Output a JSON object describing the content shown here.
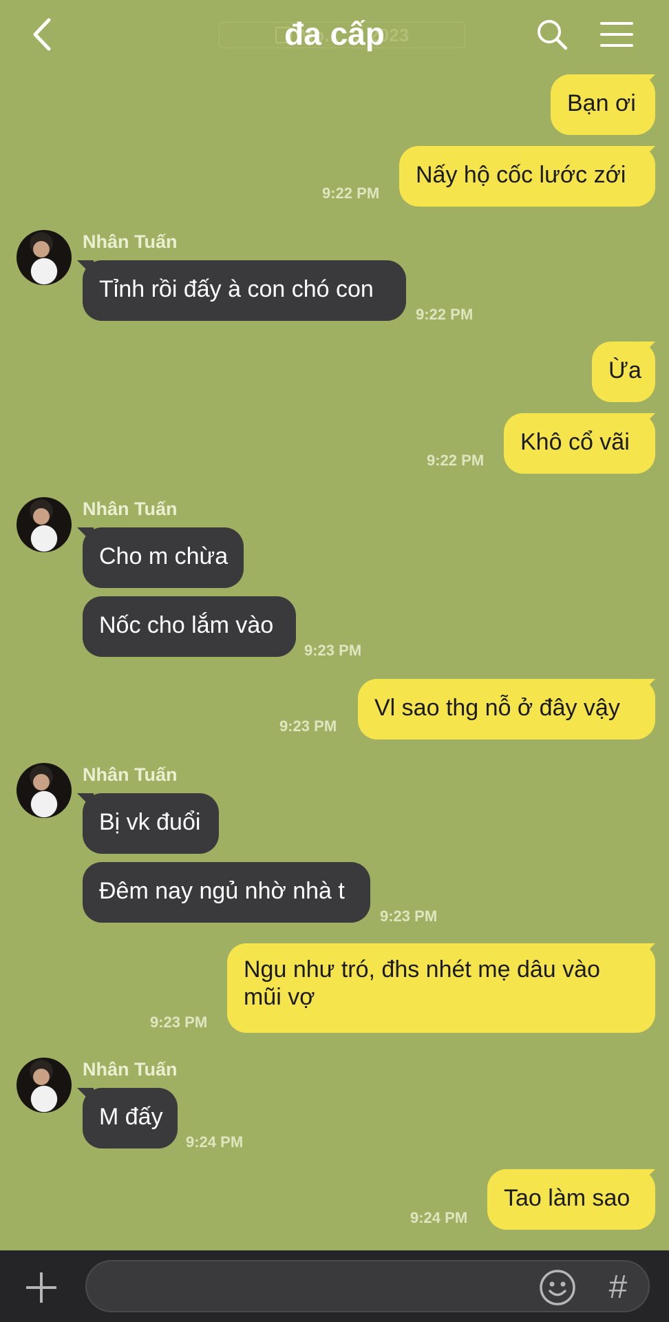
{
  "header": {
    "title": "đa cấp",
    "date_overlay": "Mo... ...l 2023",
    "icons": [
      "back-arrow-icon",
      "search-icon",
      "menu-icon"
    ]
  },
  "messages": [
    {
      "dir": "out",
      "text": "Bạn ơi"
    },
    {
      "dir": "out",
      "text": "Nấy hộ cốc lước zới",
      "time": "9:22 PM"
    },
    {
      "dir": "in",
      "sender": "Nhân Tuấn",
      "text": "Tỉnh rồi đấy à con chó con",
      "time": "9:22 PM"
    },
    {
      "dir": "out",
      "text": "Ừa"
    },
    {
      "dir": "out",
      "text": "Khô cổ vãi",
      "time": "9:22 PM"
    },
    {
      "dir": "in",
      "sender": "Nhân Tuấn",
      "text": "Cho m chừa"
    },
    {
      "dir": "in",
      "text": "Nốc cho lắm vào",
      "time": "9:23 PM"
    },
    {
      "dir": "out",
      "text": "Vl sao thg nỗ ở đây vậy",
      "time": "9:23 PM"
    },
    {
      "dir": "in",
      "sender": "Nhân Tuấn",
      "text": "Bị vk đuổi"
    },
    {
      "dir": "in",
      "text": "Đêm nay ngủ nhờ nhà t",
      "time": "9:23 PM"
    },
    {
      "dir": "out",
      "text_line1": "Ngu như tró, đhs nhét mẹ dâu vào",
      "text_line2": "mũi vợ",
      "time": "9:23 PM"
    },
    {
      "dir": "in",
      "sender": "Nhân Tuấn",
      "text": "M đấy",
      "time": "9:24 PM"
    },
    {
      "dir": "out",
      "text": "Tao làm sao",
      "time": "9:24 PM"
    }
  ],
  "composer": {
    "placeholder": "",
    "icons": [
      "plus-icon",
      "emoji-icon",
      "hashtag-icon"
    ],
    "hash_symbol": "#"
  },
  "colors": {
    "background": "#a0b062",
    "outgoing_bubble": "#f5e44c",
    "incoming_bubble": "#3a3a3c",
    "composer_bar": "#252527"
  }
}
